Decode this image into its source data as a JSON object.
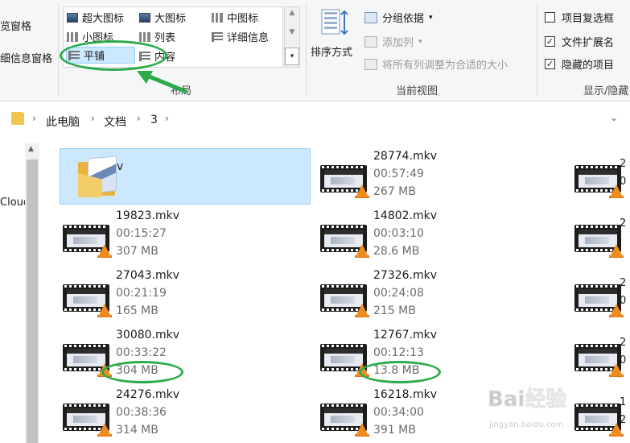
{
  "ribbon": {
    "pane_items": [
      "览窗格",
      "细信息窗格"
    ],
    "layout": {
      "group_label": "布局",
      "items": [
        {
          "label": "超大图标",
          "icon": "extra-large-icons-icon"
        },
        {
          "label": "大图标",
          "icon": "large-icons-icon"
        },
        {
          "label": "中图标",
          "icon": "medium-icons-icon"
        },
        {
          "label": "小图标",
          "icon": "small-icons-icon"
        },
        {
          "label": "列表",
          "icon": "list-icon"
        },
        {
          "label": "详细信息",
          "icon": "details-icon"
        },
        {
          "label": "平铺",
          "icon": "tiles-icon",
          "selected": true
        },
        {
          "label": "内容",
          "icon": "content-icon"
        }
      ]
    },
    "current_view": {
      "group_label": "当前视图",
      "sort_label": "排序方式",
      "group_by": "分组依据",
      "add_column": "添加列",
      "size_all_columns": "将所有列调整为合适的大小"
    },
    "show_hide": {
      "group_label": "显示/隐藏",
      "items": [
        {
          "label": "项目复选框",
          "checked": false
        },
        {
          "label": "文件扩展名",
          "checked": true
        },
        {
          "label": "隐藏的项目",
          "checked": true
        }
      ]
    }
  },
  "address": {
    "crumbs": [
      "此电脑",
      "文档",
      "3"
    ]
  },
  "nav": {
    "partial_label": "Cloud"
  },
  "files": [
    {
      "name": "v",
      "type": "folder",
      "selected": true
    },
    {
      "name": "28774.mkv",
      "duration": "00:57:49",
      "size": "267 MB"
    },
    {
      "name": "19823.mkv",
      "duration": "00:15:27",
      "size": "307 MB"
    },
    {
      "name": "14802.mkv",
      "duration": "00:03:10",
      "size": "28.6 MB"
    },
    {
      "name": "27043.mkv",
      "duration": "00:21:19",
      "size": "165 MB"
    },
    {
      "name": "27326.mkv",
      "duration": "00:24:08",
      "size": "215 MB"
    },
    {
      "name": "30080.mkv",
      "duration": "00:33:22",
      "size": "304 MB"
    },
    {
      "name": "12767.mkv",
      "duration": "00:12:13",
      "size": "13.8 MB"
    },
    {
      "name": "24276.mkv",
      "duration": "00:38:36",
      "size": "314 MB"
    },
    {
      "name": "16218.mkv",
      "duration": "00:34:00",
      "size": "391 MB"
    }
  ],
  "clipped_column": [
    "2",
    "0",
    "2",
    "2",
    "0",
    "2",
    "0",
    "1",
    "2",
    "0"
  ],
  "watermark": {
    "text": "Bai经验",
    "url": "jingyan.baidu.com"
  },
  "colors": {
    "selection_bg": "#cce8ff",
    "selection_border": "#99d1ff",
    "annotation_green": "#2bab4a"
  }
}
